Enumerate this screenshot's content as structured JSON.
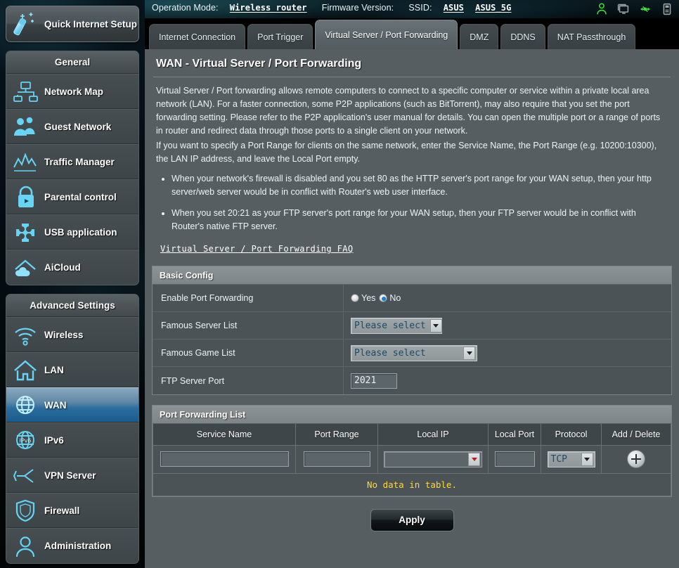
{
  "topbar": {
    "operation_mode_label": "Operation Mode:",
    "operation_mode_value": "Wireless router",
    "firmware_label": "Firmware Version:",
    "firmware_value": "",
    "ssid_label": "SSID:",
    "ssid_value_1": "ASUS",
    "ssid_value_2": "ASUS_5G",
    "tray_icons": [
      "user-icon",
      "monitors-icon",
      "usb-icon",
      "printer-icon"
    ]
  },
  "sidebar": {
    "quick_setup": {
      "label": "Quick Internet Setup",
      "icon": "magic-wand-icon"
    },
    "groups": [
      {
        "title": "General",
        "items": [
          {
            "label": "Network Map",
            "icon": "network-map-icon",
            "active": false
          },
          {
            "label": "Guest Network",
            "icon": "guest-network-icon",
            "active": false
          },
          {
            "label": "Traffic Manager",
            "icon": "traffic-manager-icon",
            "active": false
          },
          {
            "label": "Parental control",
            "icon": "padlock-icon",
            "active": false
          },
          {
            "label": "USB application",
            "icon": "puzzle-piece-icon",
            "active": false
          },
          {
            "label": "AiCloud",
            "icon": "aicloud-icon",
            "active": false
          }
        ]
      },
      {
        "title": "Advanced Settings",
        "items": [
          {
            "label": "Wireless",
            "icon": "wifi-icon",
            "active": false
          },
          {
            "label": "LAN",
            "icon": "home-icon",
            "active": false
          },
          {
            "label": "WAN",
            "icon": "globe-icon",
            "active": true
          },
          {
            "label": "IPv6",
            "icon": "ipv6-globe-icon",
            "active": false
          },
          {
            "label": "VPN Server",
            "icon": "vpn-key-icon",
            "active": false
          },
          {
            "label": "Firewall",
            "icon": "shield-icon",
            "active": false
          },
          {
            "label": "Administration",
            "icon": "person-icon",
            "active": false
          }
        ]
      }
    ]
  },
  "tabs": [
    {
      "label": "Internet Connection",
      "selected": false
    },
    {
      "label": "Port Trigger",
      "selected": false
    },
    {
      "label": "Virtual Server / Port Forwarding",
      "selected": true
    },
    {
      "label": "DMZ",
      "selected": false
    },
    {
      "label": "DDNS",
      "selected": false
    },
    {
      "label": "NAT Passthrough",
      "selected": false
    }
  ],
  "page": {
    "title": "WAN - Virtual Server / Port Forwarding",
    "paragraph_1": "Virtual Server / Port forwarding allows remote computers to connect to a specific computer or service within a private local area network (LAN). For a faster connection, some P2P applications (such as BitTorrent), may also require that you set the port forwarding setting. Please refer to the P2P application's user manual for details. You can open the multiple port or a range of ports in router and redirect data through those ports to a single client on your network.",
    "paragraph_2": "If you want to specify a Port Range for clients on the same network, enter the Service Name, the Port Range (e.g. 10200:10300), the LAN IP address, and leave the Local Port empty.",
    "bullets": [
      "When your network's firewall is disabled and you set 80 as the HTTP server's port range for your WAN setup, then your http server/web server would be in conflict with Router's web user interface.",
      "When you set 20:21 as your FTP server's port range for your WAN setup, then your FTP server would be in conflict with Router's native FTP server."
    ],
    "faq_link": "Virtual Server / Port Forwarding FAQ"
  },
  "basic_config": {
    "header": "Basic Config",
    "enable_port_forwarding": {
      "label": "Enable Port Forwarding",
      "options": [
        {
          "label": "Yes",
          "selected": false
        },
        {
          "label": "No",
          "selected": true
        }
      ]
    },
    "famous_server_list": {
      "label": "Famous Server List",
      "value": "Please select"
    },
    "famous_game_list": {
      "label": "Famous Game List",
      "value": "Please select"
    },
    "ftp_server_port": {
      "label": "FTP Server Port",
      "value": "2021"
    }
  },
  "port_forwarding_list": {
    "header": "Port Forwarding List",
    "columns": [
      "Service Name",
      "Port Range",
      "Local IP",
      "Local Port",
      "Protocol",
      "Add / Delete"
    ],
    "input_row": {
      "service_name": "",
      "port_range": "",
      "local_ip": "",
      "local_port": "",
      "protocol": "TCP",
      "add_icon": "plus-circle-icon"
    },
    "empty_message": "No data in table."
  },
  "footer": {
    "apply_label": "Apply"
  },
  "colors": {
    "panel_bg": "#565e62",
    "row_bg": "#4b5357",
    "section_header": "#838a8e",
    "accent_blue": "#2a6d9e",
    "warning_yellow": "#ffd83d",
    "icon_cyan": "#6fd8f5",
    "tray_green": "#3ddc3d"
  }
}
